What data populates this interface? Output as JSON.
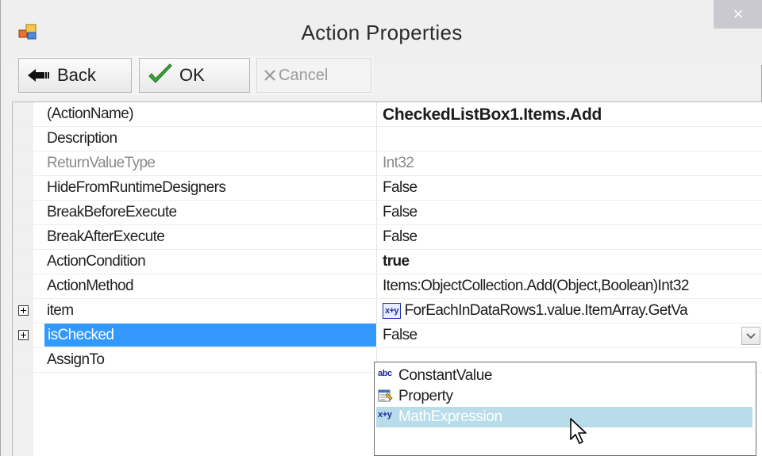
{
  "window": {
    "title": "Action Properties",
    "close_glyph": "×"
  },
  "toolbar": {
    "back_label": "Back",
    "ok_label": "OK",
    "cancel_label": "Cancel"
  },
  "properties": [
    {
      "name": "(ActionName)",
      "value": "CheckedListBox1.Items.Add"
    },
    {
      "name": "Description",
      "value": ""
    },
    {
      "name": "ReturnValueType",
      "value": "Int32"
    },
    {
      "name": "HideFromRuntimeDesigners",
      "value": "False"
    },
    {
      "name": "BreakBeforeExecute",
      "value": "False"
    },
    {
      "name": "BreakAfterExecute",
      "value": "False"
    },
    {
      "name": "ActionCondition",
      "value": "true"
    },
    {
      "name": "ActionMethod",
      "value": "Items:ObjectCollection.Add(Object,Boolean)Int32"
    },
    {
      "name": "item",
      "value": "ForEachInDataRows1.value.ItemArray.GetVa",
      "badge": "x+y"
    },
    {
      "name": "isChecked",
      "value": "False"
    },
    {
      "name": "AssignTo",
      "value": ""
    }
  ],
  "dropdown": {
    "items": [
      {
        "label": "ConstantValue",
        "icon": "abc-icon",
        "icon_text": "abc"
      },
      {
        "label": "Property",
        "icon": "property-icon"
      },
      {
        "label": "MathExpression",
        "icon": "math-expression-icon",
        "icon_text": "x+y"
      }
    ],
    "hovered_index": 2
  },
  "colors": {
    "selection": "#3399ff",
    "hover": "#b9dcea",
    "ok_check": "#3aa832"
  }
}
